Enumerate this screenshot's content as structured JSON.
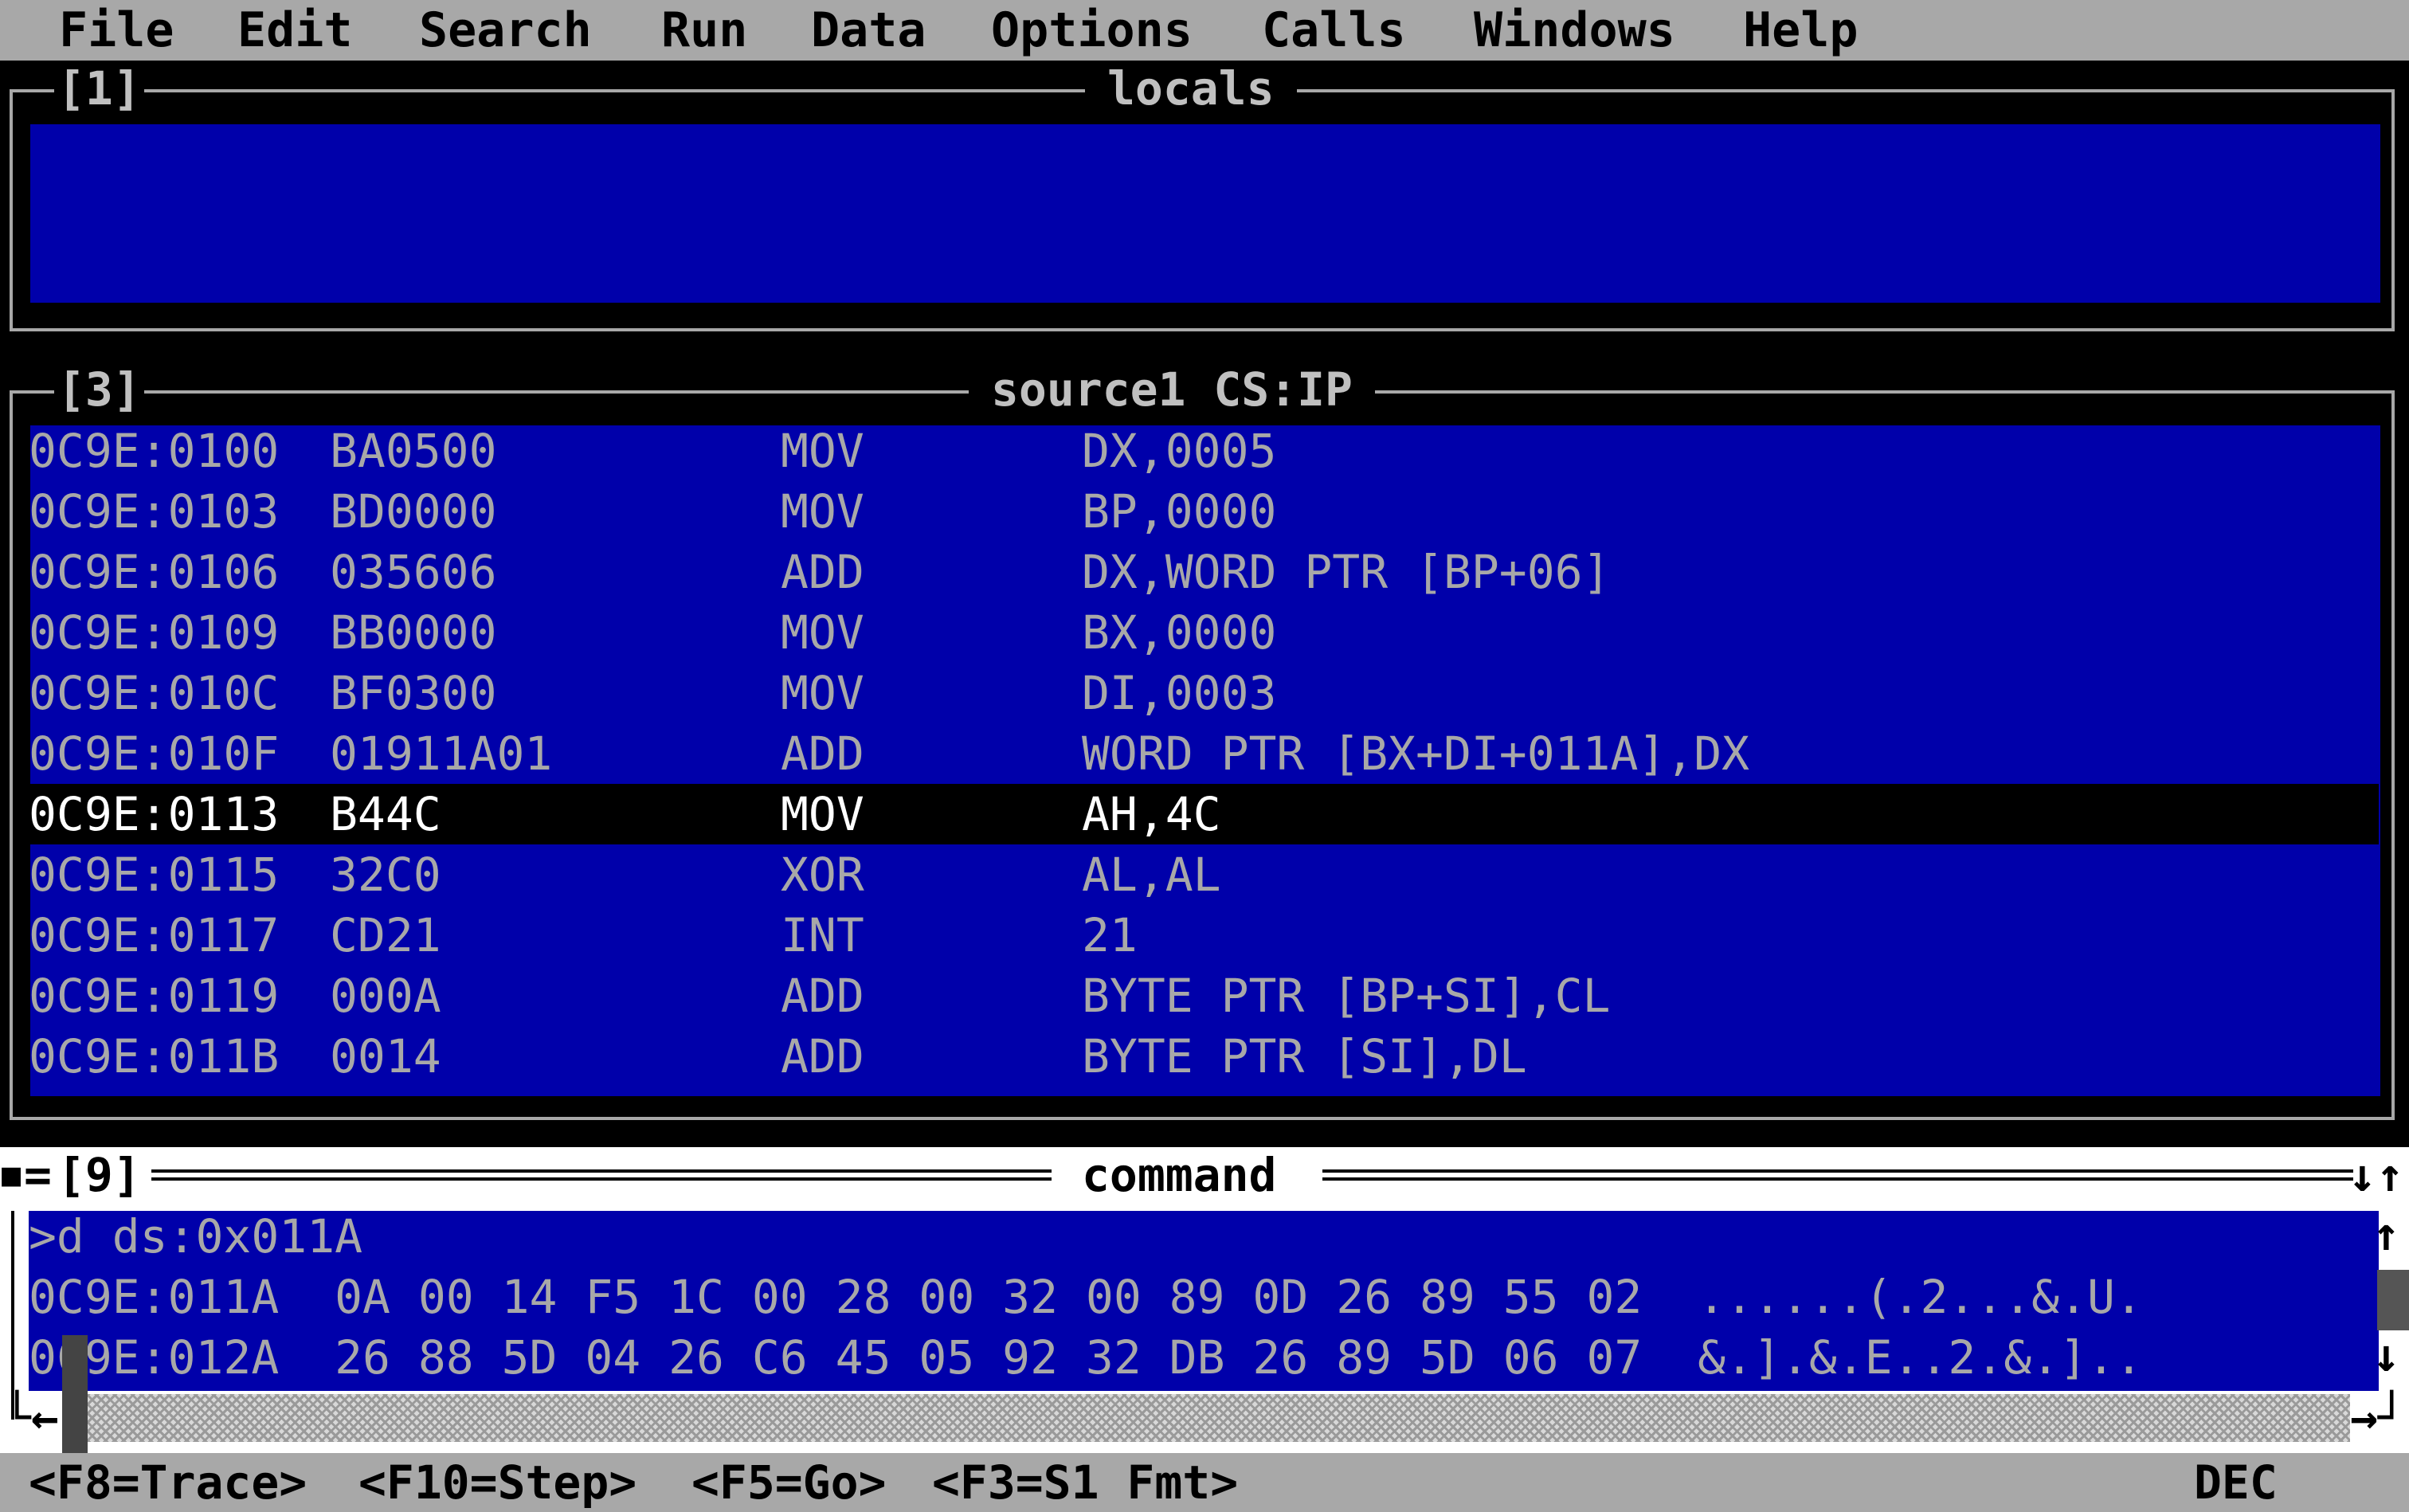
{
  "menu": [
    "File",
    "Edit",
    "Search",
    "Run",
    "Data",
    "Options",
    "Calls",
    "Windows",
    "Help"
  ],
  "locals_window": {
    "number": "[1]",
    "title": "locals"
  },
  "source_window": {
    "number": "[3]",
    "title": "source1 CS:IP",
    "rows": [
      {
        "addr": "0C9E:0100",
        "bytes": "BA0500",
        "mnemonic": "MOV",
        "operands": "DX,0005"
      },
      {
        "addr": "0C9E:0103",
        "bytes": "BD0000",
        "mnemonic": "MOV",
        "operands": "BP,0000"
      },
      {
        "addr": "0C9E:0106",
        "bytes": "035606",
        "mnemonic": "ADD",
        "operands": "DX,WORD PTR [BP+06]"
      },
      {
        "addr": "0C9E:0109",
        "bytes": "BB0000",
        "mnemonic": "MOV",
        "operands": "BX,0000"
      },
      {
        "addr": "0C9E:010C",
        "bytes": "BF0300",
        "mnemonic": "MOV",
        "operands": "DI,0003"
      },
      {
        "addr": "0C9E:010F",
        "bytes": "01911A01",
        "mnemonic": "ADD",
        "operands": "WORD PTR [BX+DI+011A],DX"
      },
      {
        "addr": "0C9E:0113",
        "bytes": "B44C",
        "mnemonic": "MOV",
        "operands": "AH,4C"
      },
      {
        "addr": "0C9E:0115",
        "bytes": "32C0",
        "mnemonic": "XOR",
        "operands": "AL,AL"
      },
      {
        "addr": "0C9E:0117",
        "bytes": "CD21",
        "mnemonic": "INT",
        "operands": "21"
      },
      {
        "addr": "0C9E:0119",
        "bytes": "000A",
        "mnemonic": "ADD",
        "operands": "BYTE PTR [BP+SI],CL"
      },
      {
        "addr": "0C9E:011B",
        "bytes": "0014",
        "mnemonic": "ADD",
        "operands": "BYTE PTR [SI],DL"
      }
    ],
    "current_row_index": 6
  },
  "command_window": {
    "number": "[9]",
    "title": "command",
    "lines": [
      ">d ds:0x011A",
      "0C9E:011A  0A 00 14 F5 1C 00 28 00 32 00 89 0D 26 89 55 02  ......(.2...&.U.",
      "0C9E:012A  26 88 5D 04 26 C6 45 05 92 32 DB 26 89 5D 06 07  &.].&.E..2.&.].."
    ]
  },
  "statusbar": {
    "trace": "<F8=Trace>",
    "step": "<F10=Step>",
    "go": "<F5=Go>",
    "fmt": "<F3=S1 Fmt>",
    "radix": "DEC"
  },
  "colors": {
    "menu_bg": "#a8a8a8",
    "window_bg": "#0000aa",
    "text": "#a8a8a8",
    "current_line_bg": "#000000"
  }
}
